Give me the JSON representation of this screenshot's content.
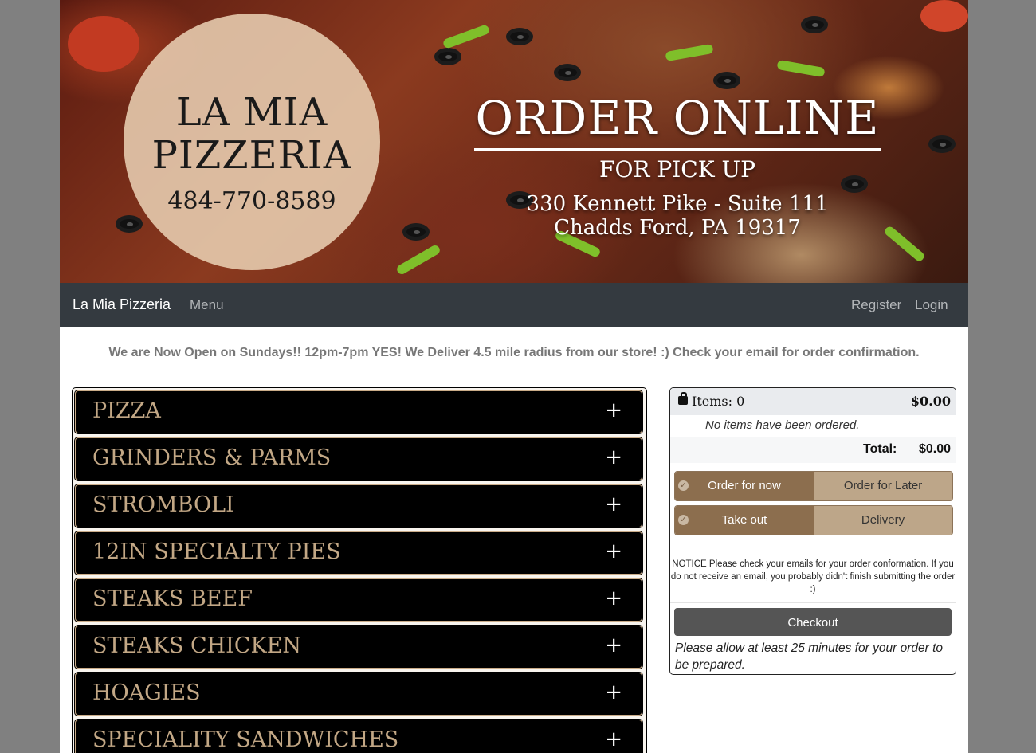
{
  "banner": {
    "logo_line1": "LA MIA",
    "logo_line2": "PIZZERIA",
    "phone": "484-770-8589",
    "headline": "ORDER ONLINE",
    "subheadline": "FOR PICK UP",
    "address_line1": "330 Kennett Pike - Suite 111",
    "address_line2": "Chadds Ford, PA 19317"
  },
  "navbar": {
    "brand": "La Mia Pizzeria",
    "menu": "Menu",
    "register": "Register",
    "login": "Login"
  },
  "announcement": "We are Now Open on Sundays!! 12pm-7pm YES! We Deliver 4.5 mile radius from our store! :) Check your email for order confirmation.",
  "categories": [
    "PIZZA",
    "GRINDERS & PARMS",
    "STROMBOLI",
    "12IN SPECIALTY PIES",
    "STEAKS BEEF",
    "STEAKS CHICKEN",
    "HOAGIES",
    "SPECIALITY SANDWICHES"
  ],
  "expand_symbol": "+",
  "cart": {
    "items_label": "Items: 0",
    "header_total": "$0.00",
    "empty_message": "No items have been ordered.",
    "total_label": "Total:",
    "total_value": "$0.00",
    "timing": {
      "selected": "Order for now",
      "other": "Order for Later"
    },
    "method": {
      "selected": "Take out",
      "other": "Delivery"
    },
    "notice": "NOTICE Please check your emails for your order conformation. If you do not receive an email, you probably didn't finish submitting the order :)",
    "checkout": "Checkout",
    "prep_note": "Please allow at least 25 minutes for your order to be prepared."
  },
  "colors": {
    "navbar": "#343a40",
    "category_bg": "#000000",
    "category_text": "#c2a785",
    "toggle_selected": "#8c6e4e",
    "toggle_unselected": "#bda689",
    "checkout": "#555555"
  },
  "icons": [
    "shopping-bag-icon",
    "check-circle-icon",
    "plus-icon"
  ]
}
